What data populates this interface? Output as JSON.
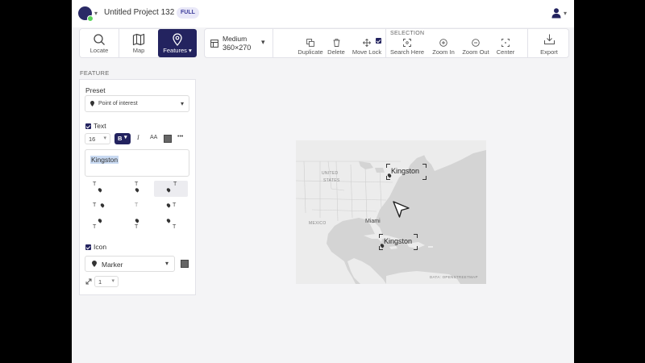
{
  "header": {
    "project_title": "Untitled Project 132",
    "plan_badge": "FULL"
  },
  "toolbar": {
    "tools": [
      {
        "name": "locate",
        "label": "Locate",
        "icon": "search-icon"
      },
      {
        "name": "map",
        "label": "Map",
        "icon": "map-icon"
      },
      {
        "name": "features",
        "label": "Features",
        "icon": "pin-icon",
        "active": true
      }
    ],
    "size": {
      "name": "Medium",
      "dims": "360×270"
    },
    "actions": [
      {
        "name": "duplicate",
        "label": "Duplicate",
        "icon": "duplicate-icon"
      },
      {
        "name": "delete",
        "label": "Delete",
        "icon": "trash-icon"
      },
      {
        "name": "move-lock",
        "label": "Move Lock",
        "icon": "move-icon",
        "checked": true
      }
    ],
    "selection_title": "SELECTION",
    "selection_actions": [
      {
        "name": "search-here",
        "label": "Search Here",
        "icon": "focus-icon"
      },
      {
        "name": "zoom-in",
        "label": "Zoom In",
        "icon": "zoom-in-icon"
      },
      {
        "name": "zoom-out",
        "label": "Zoom Out",
        "icon": "zoom-out-icon"
      },
      {
        "name": "center",
        "label": "Center",
        "icon": "center-icon"
      }
    ],
    "export_label": "Export"
  },
  "feature_panel": {
    "section_title": "FEATURE",
    "preset_label": "Preset",
    "preset_value": "Point of interest",
    "text_label": "Text",
    "text_checked": true,
    "font_size": "16",
    "bold_label": "B",
    "italic_label": "I",
    "case_label": "Aa",
    "more_label": "•••",
    "text_value": "Kingston",
    "position_glyph": "T",
    "icon_label": "Icon",
    "icon_checked": true,
    "icon_value": "Marker",
    "icon_size": "1"
  },
  "map": {
    "region_labels": [
      "UNITED",
      "STATES",
      "MEXICO"
    ],
    "city": "Miami",
    "marker_labels": [
      "Kingston",
      "Kingston"
    ],
    "attribution": "DATA: OPENSTREETMAP"
  },
  "colors": {
    "accent": "#23235f",
    "badge_bg": "#e9e8f8",
    "map_land": "#ececec",
    "map_water": "#d4d4d4"
  }
}
